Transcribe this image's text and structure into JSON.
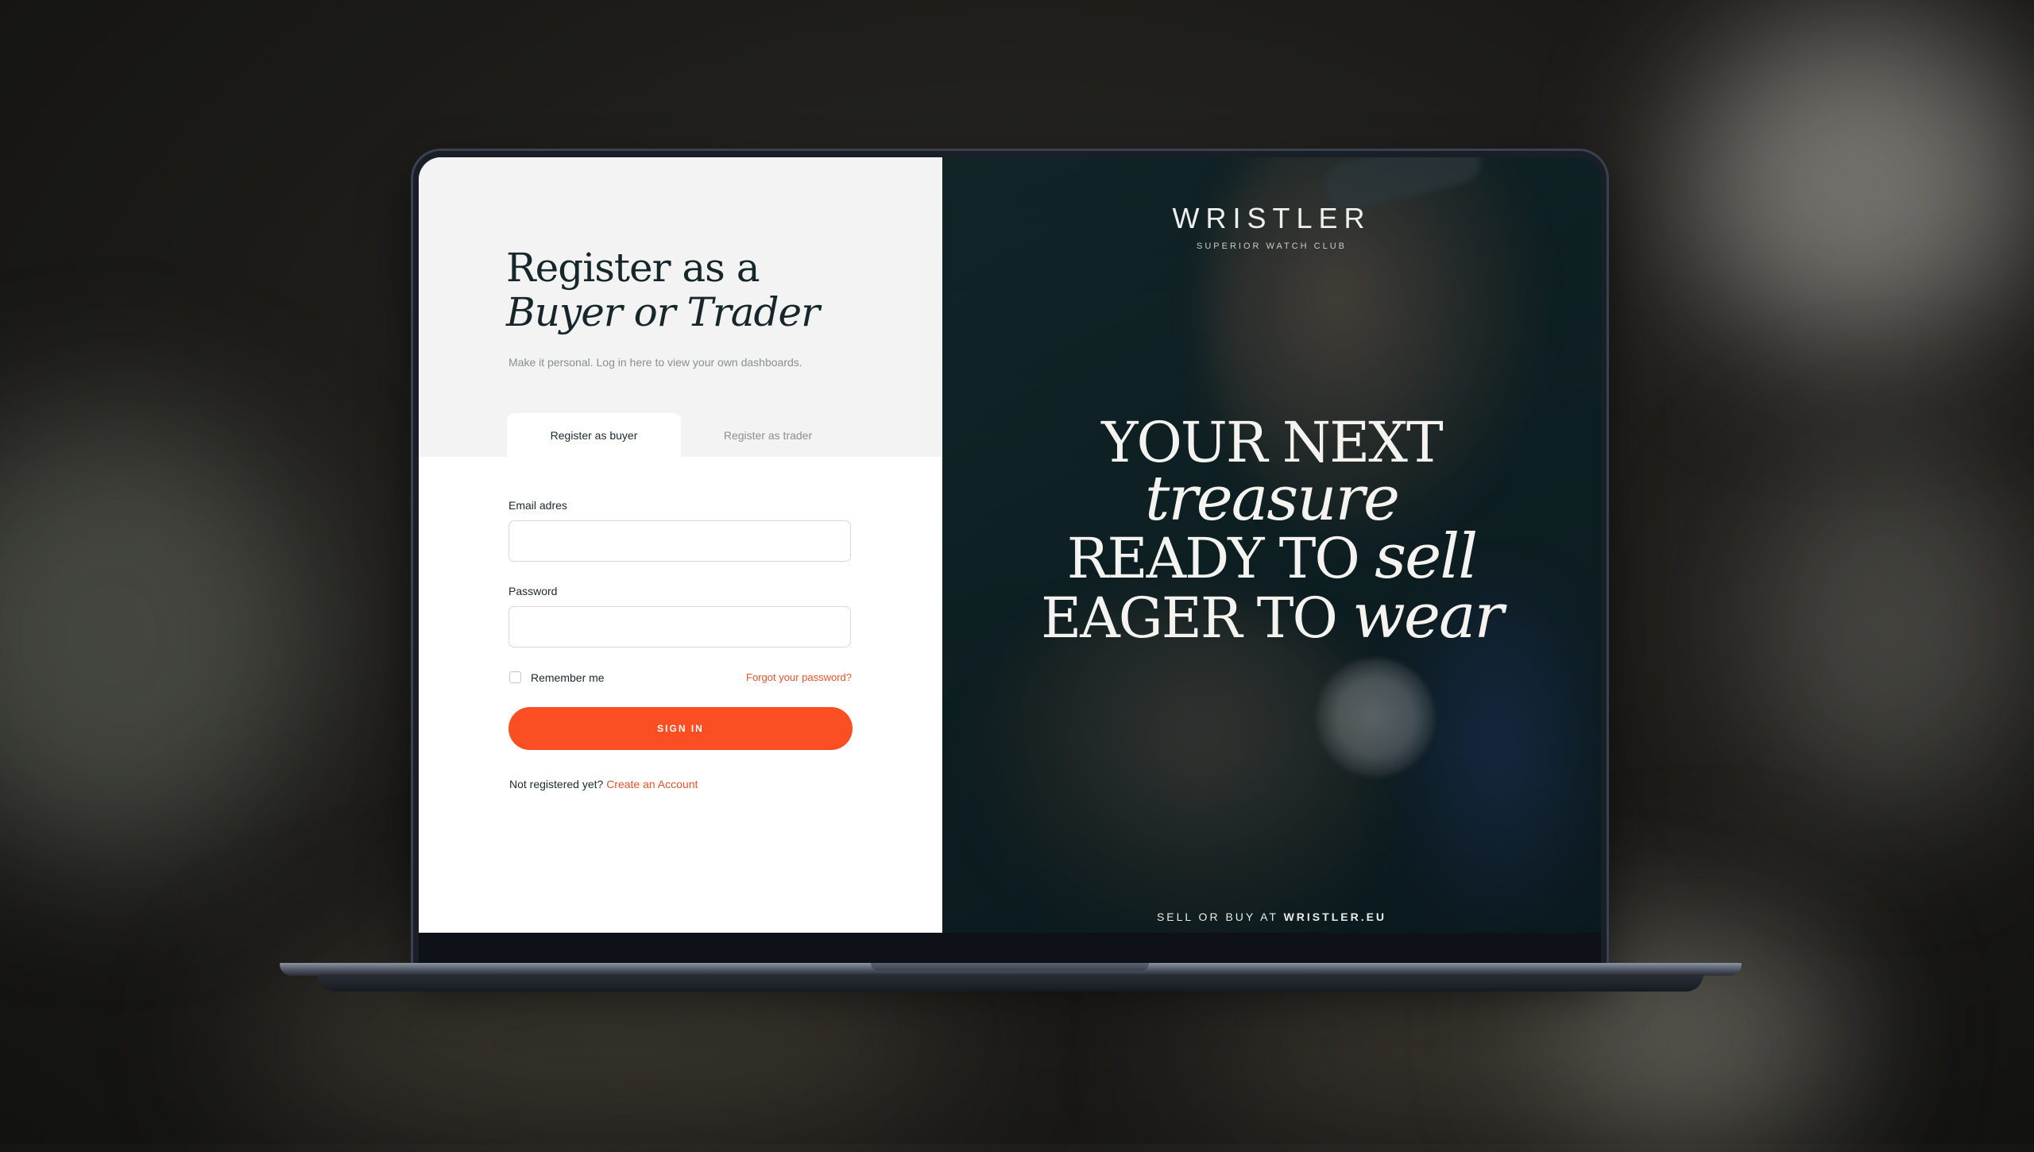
{
  "colors": {
    "accent": "#fb4e22",
    "link": "#e5532a",
    "heading": "#16262a",
    "panel_dark": "#0f2124",
    "panel_light": "#f2f3f2"
  },
  "form": {
    "heading_line1": "Register as a",
    "heading_line2": "Buyer or Trader",
    "subtitle": "Make it personal. Log in here to view your own dashboards.",
    "tabs": [
      {
        "label": "Register as buyer",
        "active": true
      },
      {
        "label": "Register as trader",
        "active": false
      }
    ],
    "email_label": "Email adres",
    "email_value": "",
    "password_label": "Password",
    "password_value": "",
    "remember_label": "Remember me",
    "remember_checked": false,
    "forgot_label": "Forgot your password?",
    "signin_label": "SIGN IN",
    "not_registered_text": "Not registered yet?",
    "create_account_label": "Create an Account"
  },
  "promo": {
    "logo": "WRISTLER",
    "tagline": "SUPERIOR WATCH CLUB",
    "line1": "YOUR NEXT",
    "line2": "treasure",
    "line3_a": "READY TO",
    "line3_b": "sell",
    "line4_a": "EAGER TO",
    "line4_b": "wear",
    "footer_prefix": "SELL OR BUY AT",
    "footer_domain": "WRISTLER.EU"
  }
}
